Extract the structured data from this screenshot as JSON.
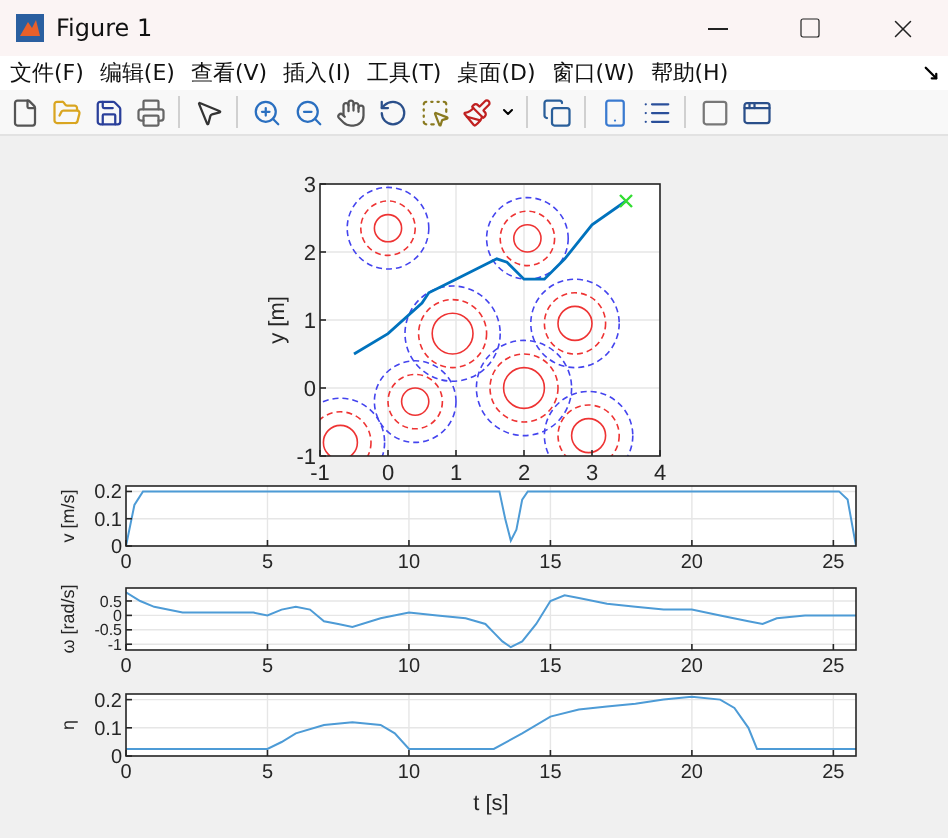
{
  "window": {
    "title": "Figure 1"
  },
  "menu": [
    "文件(F)",
    "编辑(E)",
    "查看(V)",
    "插入(I)",
    "工具(T)",
    "桌面(D)",
    "窗口(W)",
    "帮助(H)"
  ],
  "toolbar": [
    {
      "kind": "new"
    },
    {
      "kind": "open"
    },
    {
      "kind": "save"
    },
    {
      "kind": "print"
    },
    {
      "kind": "sep"
    },
    {
      "kind": "pointer"
    },
    {
      "kind": "sep"
    },
    {
      "kind": "zoom-in"
    },
    {
      "kind": "zoom-out"
    },
    {
      "kind": "pan"
    },
    {
      "kind": "rotate"
    },
    {
      "kind": "cursor"
    },
    {
      "kind": "brush"
    },
    {
      "kind": "sep"
    },
    {
      "kind": "link"
    },
    {
      "kind": "sep"
    },
    {
      "kind": "colorbar"
    },
    {
      "kind": "legend"
    },
    {
      "kind": "sep"
    },
    {
      "kind": "hide"
    },
    {
      "kind": "show"
    }
  ],
  "axes": [
    {
      "chart_data": {
        "type": "line",
        "ylabel": "y [m]",
        "xlim": [
          -1,
          4
        ],
        "ylim": [
          -1,
          3
        ],
        "xticks": [
          -1,
          0,
          1,
          2,
          3,
          4
        ],
        "yticks": [
          -1,
          0,
          1,
          2,
          3
        ],
        "x": [
          -0.5,
          0,
          0.5,
          0.6,
          1.0,
          1.6,
          1.75,
          2.0,
          2.3,
          2.6,
          3.0,
          3.5
        ],
        "grid": true,
        "series": [
          {
            "color": "#0072bd",
            "values": [
              0.5,
              0.8,
              1.25,
              1.4,
              1.6,
              1.9,
              1.85,
              1.6,
              1.6,
              1.9,
              2.4,
              2.75
            ]
          }
        ]
      }
    },
    {
      "chart_data": {
        "type": "line",
        "ylabel": "v [m/s]",
        "xlim": [
          0,
          25.8
        ],
        "ylim": [
          0,
          0.22
        ],
        "xticks": [
          0,
          5,
          10,
          15,
          20,
          25
        ],
        "yticks": [
          0,
          0.1,
          0.2
        ],
        "x": [
          0,
          0.3,
          0.6,
          13.2,
          13.4,
          13.6,
          13.8,
          14.0,
          14.2,
          25.2,
          25.5,
          25.8
        ],
        "grid": true,
        "series": [
          {
            "color": "#4d9bd6",
            "values": [
              0,
              0.15,
              0.2,
              0.2,
              0.1,
              0.02,
              0.06,
              0.17,
              0.2,
              0.2,
              0.17,
              0.0
            ]
          }
        ]
      }
    },
    {
      "chart_data": {
        "type": "line",
        "ylabel": "ω [rad/s]",
        "xlim": [
          0,
          25.8
        ],
        "ylim": [
          -1.2,
          0.95
        ],
        "xticks": [
          0,
          5,
          10,
          15,
          20,
          25
        ],
        "yticks": [
          -1,
          -0.5,
          0,
          0.5
        ],
        "x": [
          0,
          0.5,
          1,
          2,
          3,
          4,
          4.5,
          5,
          5.5,
          6,
          6.5,
          7,
          7.5,
          8,
          9,
          10,
          11,
          12,
          12.7,
          13,
          13.3,
          13.6,
          14,
          14.5,
          15,
          15.5,
          16,
          17,
          18,
          19,
          20,
          21,
          22,
          22.5,
          23,
          24,
          25,
          25.8
        ],
        "grid": true,
        "series": [
          {
            "color": "#4d9bd6",
            "values": [
              0.8,
              0.5,
              0.3,
              0.1,
              0.1,
              0.1,
              0.1,
              0,
              0.2,
              0.3,
              0.2,
              -0.2,
              -0.3,
              -0.4,
              -0.1,
              0.1,
              0,
              -0.1,
              -0.3,
              -0.6,
              -0.9,
              -1.1,
              -0.9,
              -0.3,
              0.5,
              0.7,
              0.6,
              0.4,
              0.3,
              0.2,
              0.2,
              0,
              -0.2,
              -0.3,
              -0.1,
              0,
              0,
              0
            ]
          }
        ]
      }
    },
    {
      "chart_data": {
        "type": "line",
        "ylabel": "η",
        "xlabel": "t [s]",
        "xlim": [
          0,
          25.8
        ],
        "ylim": [
          0,
          0.22
        ],
        "xticks": [
          0,
          5,
          10,
          15,
          20,
          25
        ],
        "yticks": [
          0,
          0.1,
          0.2
        ],
        "x": [
          0,
          5,
          5.5,
          6,
          7,
          8,
          9,
          9.5,
          10,
          13,
          14,
          15,
          16,
          17,
          18,
          19,
          20,
          21,
          21.5,
          22,
          22.3,
          25.8
        ],
        "grid": true,
        "series": [
          {
            "color": "#4d9bd6",
            "values": [
              0.025,
              0.025,
              0.05,
              0.08,
              0.11,
              0.12,
              0.11,
              0.08,
              0.025,
              0.025,
              0.08,
              0.14,
              0.165,
              0.175,
              0.185,
              0.2,
              0.21,
              0.2,
              0.17,
              0.1,
              0.025,
              0.025
            ]
          }
        ]
      }
    }
  ]
}
